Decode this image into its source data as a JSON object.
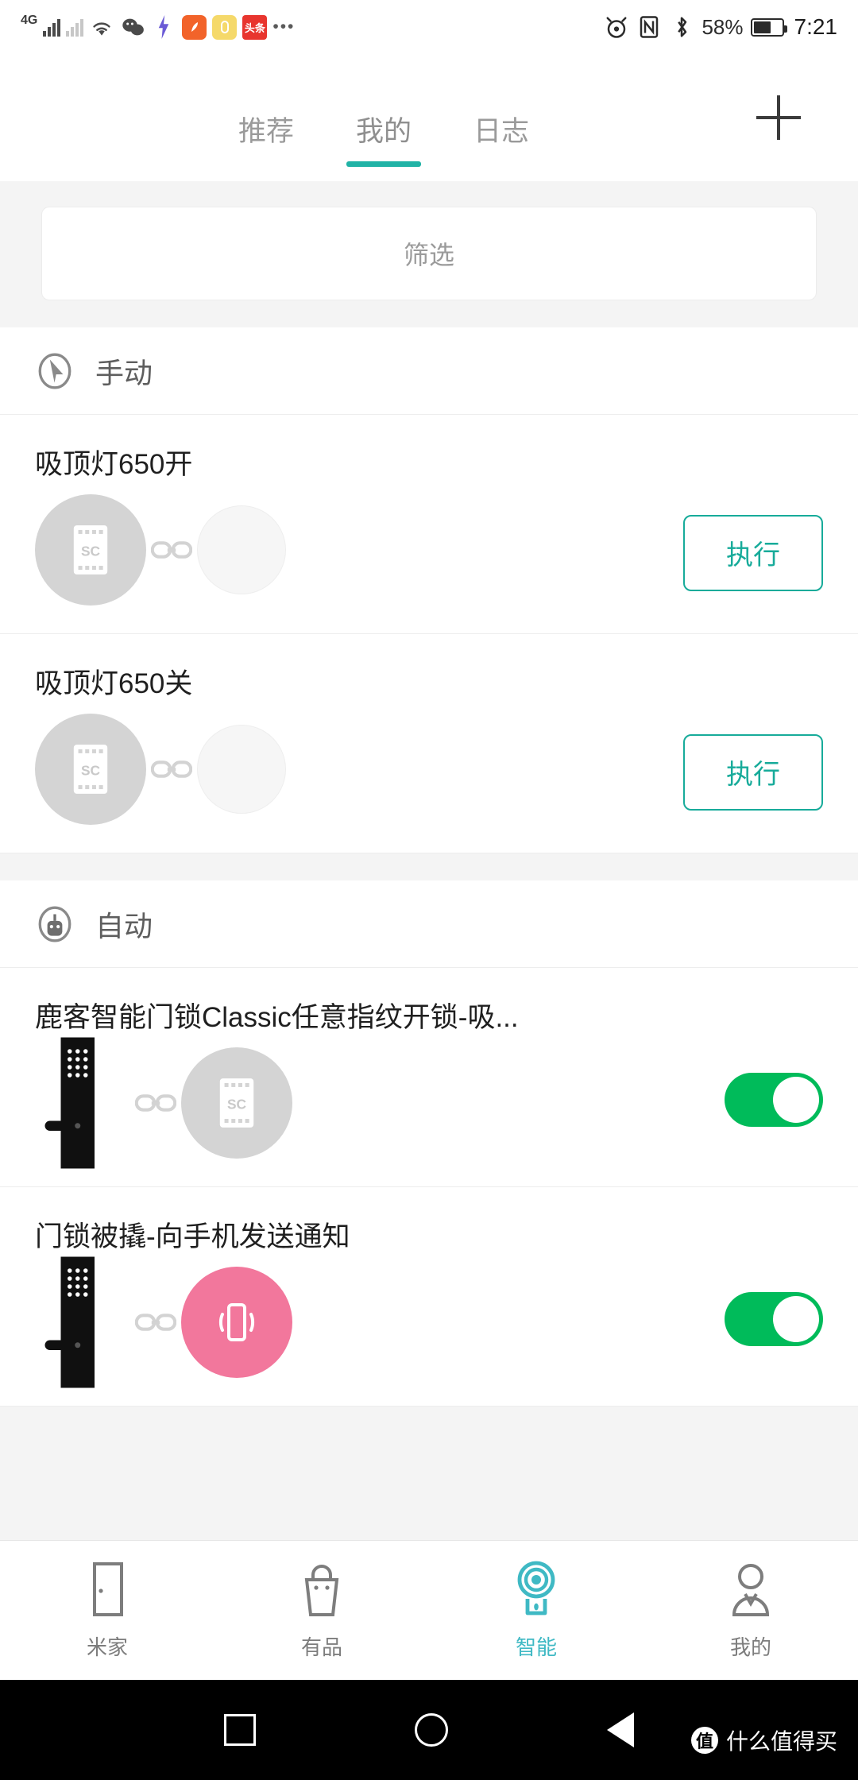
{
  "status_bar": {
    "network": "4G",
    "battery_percent": "58%",
    "time": "7:21",
    "icons": [
      "signal-bars-icon",
      "wifi-icon",
      "wechat-icon",
      "flash-icon",
      "app-icon-orange",
      "app-icon-yellow",
      "toutiao-icon",
      "more-dots-icon",
      "eye-care-icon",
      "nfc-icon",
      "bluetooth-icon",
      "battery-icon"
    ]
  },
  "header": {
    "tabs": [
      {
        "label": "推荐",
        "active": false
      },
      {
        "label": "我的",
        "active": true
      },
      {
        "label": "日志",
        "active": false
      }
    ],
    "add_button": "add-icon",
    "accent_color": "#21b3a6"
  },
  "filter": {
    "label": "筛选"
  },
  "sections": [
    {
      "icon": "cursor-click-icon",
      "title": "手动",
      "rows": [
        {
          "title": "吸顶灯650开",
          "devices": [
            "gateway-icon",
            "ceiling-lamp-icon"
          ],
          "action_type": "button",
          "action_label": "执行"
        },
        {
          "title": "吸顶灯650关",
          "devices": [
            "gateway-icon",
            "ceiling-lamp-icon"
          ],
          "action_type": "button",
          "action_label": "执行"
        }
      ]
    },
    {
      "icon": "robot-icon",
      "title": "自动",
      "rows": [
        {
          "title": "鹿客智能门锁Classic任意指纹开锁-吸...",
          "devices": [
            "smart-lock-icon",
            "gateway-icon"
          ],
          "action_type": "toggle",
          "toggle_on": true
        },
        {
          "title": "门锁被撬-向手机发送通知",
          "devices": [
            "smart-lock-icon",
            "phone-notify-icon"
          ],
          "action_type": "toggle",
          "toggle_on": true
        }
      ]
    }
  ],
  "bottom_nav": {
    "items": [
      {
        "label": "米家",
        "icon": "door-icon",
        "active": false
      },
      {
        "label": "有品",
        "icon": "shopping-bag-icon",
        "active": false
      },
      {
        "label": "智能",
        "icon": "camera-icon",
        "active": true
      },
      {
        "label": "我的",
        "icon": "person-icon",
        "active": false
      }
    ],
    "active_color": "#3fb9c4"
  },
  "system_nav": {
    "buttons": [
      "recents-square-icon",
      "home-circle-icon",
      "back-triangle-icon"
    ]
  },
  "watermark": {
    "badge": "值",
    "text": "什么值得买"
  },
  "colors": {
    "teal": "#17ab9a",
    "green": "#00bb5a",
    "pink": "#f2779c",
    "grey_device": "#d4d4d4"
  }
}
